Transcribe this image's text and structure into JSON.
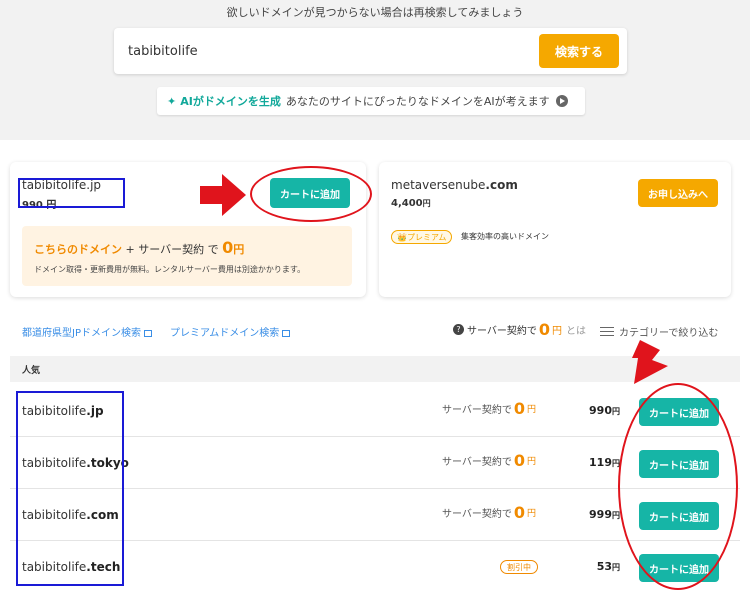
{
  "top": {
    "hint": "欲しいドメインが見つからない場合は再検索してみましょう",
    "search_value": "tabibitolife",
    "search_button": "検索する",
    "ai_spark": "✦",
    "ai_label": "AIがドメインを生成",
    "ai_desc": "あなたのサイトにぴったりなドメインをAIが考えます"
  },
  "featured_left": {
    "domain": "tabibitolife.jp",
    "price": "990 円",
    "cart_button": "カートに追加",
    "promo_orange": "こちらのドメイン",
    "promo_plus": " + サーバー契約 で ",
    "promo_zero": "0",
    "promo_yen": "円",
    "promo_note": "ドメイン取得・更新費用が無料。レンタルサーバー費用は別途かかります。"
  },
  "featured_right": {
    "domain_name": "metaversenube",
    "domain_tld": ".com",
    "price": "4,400",
    "yen": "円",
    "apply_button": "お申し込みへ",
    "premium_badge": "👑プレミアム",
    "premium_desc": "集客効率の高いドメイン"
  },
  "links": {
    "jp_search": "都道府県型JPドメイン検索",
    "premium_search": "プレミアムドメイン検索",
    "server_note_pre": "サーバー契約で",
    "server_note_zero": "0",
    "server_note_yen": "円",
    "server_note_toha": "とは",
    "filter_label": "カテゴリーで絞り込む"
  },
  "list": {
    "header": "人気",
    "rows": [
      {
        "name": "tabibitolife",
        "tld": ".jp",
        "server_pre": "サーバー契約で",
        "zero": "0",
        "yen": "円",
        "price": "990",
        "cart": "カートに追加"
      },
      {
        "name": "tabibitolife",
        "tld": ".tokyo",
        "server_pre": "サーバー契約で",
        "zero": "0",
        "yen": "円",
        "price": "119",
        "cart": "カートに追加"
      },
      {
        "name": "tabibitolife",
        "tld": ".com",
        "server_pre": "サーバー契約で",
        "zero": "0",
        "yen": "円",
        "price": "999",
        "cart": "カートに追加"
      },
      {
        "name": "tabibitolife",
        "tld": ".tech",
        "discount": "割引中",
        "price": "53",
        "yen": "円",
        "cart": "カートに追加"
      }
    ]
  },
  "colors": {
    "teal": "#16b5a6",
    "orange": "#f5a800",
    "annotation_red": "#e0141c",
    "annotation_blue": "#1a1ad6"
  }
}
